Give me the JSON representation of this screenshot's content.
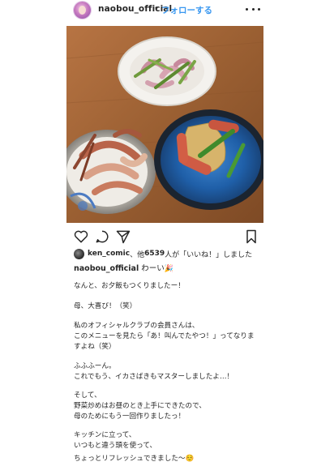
{
  "header": {
    "username": "naobou_official",
    "separator": "•",
    "follow_label": "フォローする"
  },
  "post": {
    "likes": {
      "liker": "ken_comic",
      "middle": "、他",
      "count": "6539",
      "suffix": "人が「いいね！」しました"
    },
    "caption_head": {
      "username": "naobou_official",
      "text": "わーい",
      "emoji": "🎉"
    },
    "caption_lines": [
      "なんと、お夕飯もつくりましたー！",
      "母、大喜び！（笑）",
      "私のオフィシャルクラブの会員さんは、",
      "このメニューを見たら「あ！叫んでたやつ！」ってなりま",
      "すよね（笑）",
      "ふふふーん。",
      "これでもう、イカさばきもマスターしましたよ…！",
      "そして、",
      "野菜炒めはお昼のとき上手にできたので、",
      "母のためにもう一回作りましたっ！",
      "キッチンに立って、",
      "いつもと違う頭を使って、",
      "ちょっとリフレッシュできました〜",
      "☺️"
    ]
  },
  "icons": {
    "like": "heart-icon",
    "comment": "comment-icon",
    "share": "share-icon",
    "save": "bookmark-icon",
    "more": "more-icon"
  },
  "colors": {
    "link_blue": "#3897f0",
    "text": "#262626",
    "table_wood": "#9a5f32",
    "bowl_blue": "#1f5fa8"
  }
}
